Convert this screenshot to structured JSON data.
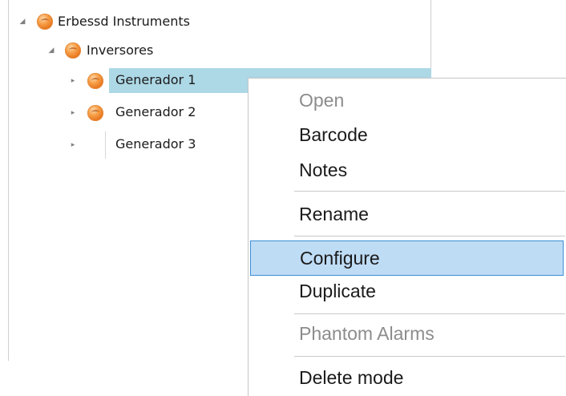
{
  "tree": {
    "root": {
      "label": "Erbessd Instruments",
      "expanded": true,
      "icon": "orange-orb-icon"
    },
    "group": {
      "label": "Inversores",
      "expanded": true,
      "icon": "orange-orb-icon"
    },
    "items": [
      {
        "label": "Generador 1",
        "selected": true,
        "icon": "orange-orb-icon"
      },
      {
        "label": "Generador 2",
        "selected": false,
        "icon": "orange-orb-icon"
      },
      {
        "label": "Generador 3",
        "selected": false,
        "icon": "none"
      }
    ]
  },
  "context_menu": {
    "items": [
      {
        "label": "Open",
        "enabled": false
      },
      {
        "label": "Barcode",
        "enabled": true
      },
      {
        "label": "Notes",
        "enabled": true
      },
      {
        "label": "Rename",
        "enabled": true
      },
      {
        "label": "Configure",
        "enabled": true,
        "hovered": true
      },
      {
        "label": "Duplicate",
        "enabled": true
      },
      {
        "label": "Phantom Alarms",
        "enabled": false
      },
      {
        "label": "Delete mode",
        "enabled": true
      }
    ]
  },
  "colors": {
    "selection": "#add8e6",
    "menu_hover": "#bfdcf5",
    "menu_hover_border": "#3d8fd6",
    "disabled_text": "#8c8c8c",
    "orb": "#e8761e"
  }
}
